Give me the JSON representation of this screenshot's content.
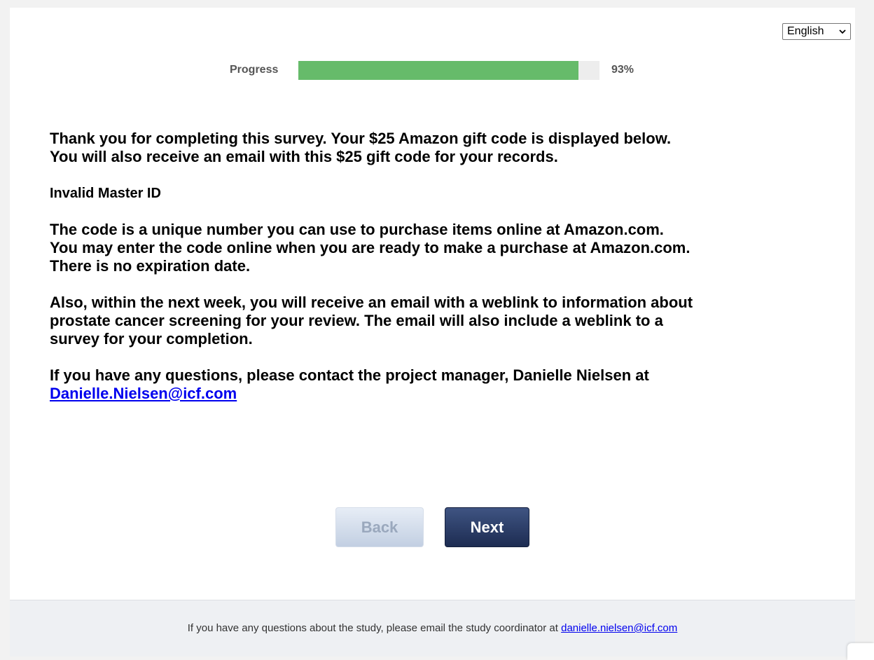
{
  "language_select": {
    "selected": "English",
    "icon": "chevron-down-icon"
  },
  "progress": {
    "label": "Progress",
    "percent_text": "93%",
    "value": 0.93,
    "color": "#66bb6a"
  },
  "message": {
    "thanks_line1": "Thank you for completing this survey. Your $25 Amazon gift code is displayed below.",
    "thanks_line2": "You will also receive an email with this $25 gift code for your records.",
    "invalid_id": "Invalid Master ID",
    "code_info_line1": "The code is a unique number you can use to purchase items online at Amazon.com.",
    "code_info_line2": "You may enter the code online when you are ready to make a purchase at Amazon.com.",
    "code_info_line3": "There is no expiration date.",
    "followup_line1": "Also, within the next week, you will receive an email with a weblink to information about",
    "followup_line2": "prostate cancer screening for your review. The email will also include a weblink to a",
    "followup_line3": "survey for your completion.",
    "contact_text": "If you have any questions, please contact the project manager, Danielle Nielsen at",
    "contact_email": "Danielle.Nielsen@icf.com"
  },
  "buttons": {
    "back": "Back",
    "next": "Next"
  },
  "footer": {
    "text": "If you have any questions about the study, please email the study coordinator at",
    "email": "danielle.nielsen@icf.com"
  }
}
